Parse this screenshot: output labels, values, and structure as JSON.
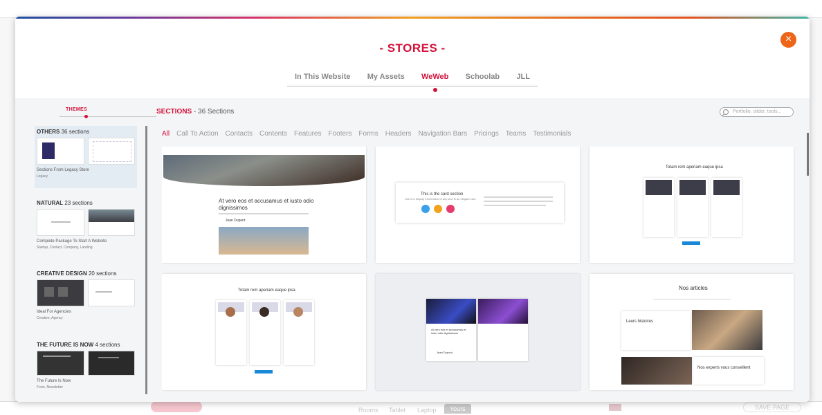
{
  "modal": {
    "title": "- STORES -",
    "close_icon": "×",
    "store_tabs": [
      {
        "label": "In This Website",
        "active": false
      },
      {
        "label": "My Assets",
        "active": false
      },
      {
        "label": "WeWeb",
        "active": true
      },
      {
        "label": "Schoolab",
        "active": false
      },
      {
        "label": "JLL",
        "active": false
      }
    ]
  },
  "sidebar": {
    "themes_label": "THEMES",
    "groups": [
      {
        "name": "OTHERS",
        "count": "36 sections",
        "desc": "Sections From Legacy Store",
        "sub": "Legacy",
        "active": true
      },
      {
        "name": "NATURAL",
        "count": "23 sections",
        "desc": "Complete Package To Start A Website",
        "sub": "Startup, Contact, Company, Landing",
        "active": false
      },
      {
        "name": "CREATIVE DESIGN",
        "count": "20 sections",
        "desc": "Ideal For Agencies",
        "sub": "Creative, Agency",
        "active": false
      },
      {
        "name": "THE FUTURE IS NOW",
        "count": "4 sections",
        "desc": "The Future Is Now",
        "sub": "Form, Newsletter",
        "active": false
      }
    ]
  },
  "main": {
    "sections_label": "SECTIONS",
    "sections_count": "- 36 Sections",
    "search_placeholder": "Portfolio, slider, tools...",
    "filters": [
      "All",
      "Call To Action",
      "Contacts",
      "Contents",
      "Features",
      "Footers",
      "Forms",
      "Headers",
      "Navigation Bars",
      "Pricings",
      "Teams",
      "Testimonials"
    ],
    "active_filter": "All",
    "cards": {
      "c1": {
        "title": "At vero eos et accusamus et iusto odio dignissimos",
        "author": "Jean Dupont"
      },
      "c2": {
        "title": "This is the card section",
        "sub": "Use it to display information of any kind in an elegant card"
      },
      "c3": {
        "title": "Totam rem aperiam eaque ipsa"
      },
      "c4": {
        "title": "Totam rem aperiam eaque ipsa"
      },
      "c5": {
        "title": "At vero eos et accusamus et iusto odio dignissimos",
        "author": "Jean Dupont"
      },
      "c6": {
        "title": "Nos articles",
        "box1": "Leurs histoires",
        "box2": "Nos experts vous conseillent"
      }
    }
  },
  "background": {
    "tabs": [
      "Rooms",
      "Tablet",
      "Laptop",
      "Yours"
    ],
    "save_label": "SAVE PAGE"
  },
  "colors": {
    "accent": "#d2113a",
    "close": "#ec6519"
  }
}
